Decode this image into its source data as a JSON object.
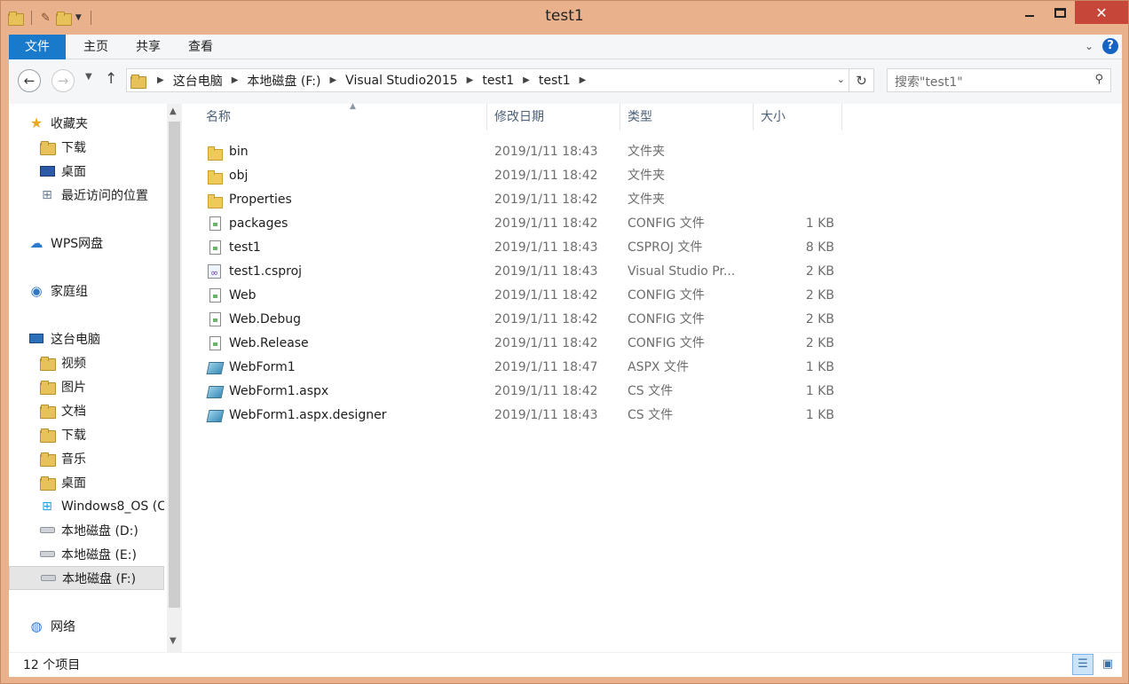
{
  "window": {
    "title": "test1"
  },
  "ribbon": {
    "tabs": [
      "文件",
      "主页",
      "共享",
      "查看"
    ]
  },
  "address": {
    "crumbs": [
      "这台电脑",
      "本地磁盘 (F:)",
      "Visual Studio2015",
      "test1",
      "test1"
    ]
  },
  "search": {
    "placeholder": "搜索\"test1\""
  },
  "nav": {
    "items": [
      {
        "label": "收藏夹",
        "icon": "star-icon",
        "level": 0
      },
      {
        "label": "下载",
        "icon": "downloads-folder-icon",
        "level": 1
      },
      {
        "label": "桌面",
        "icon": "desktop-icon",
        "level": 1
      },
      {
        "label": "最近访问的位置",
        "icon": "recent-places-icon",
        "level": 1
      },
      {
        "label": "WPS网盘",
        "icon": "cloud-icon",
        "level": 0
      },
      {
        "label": "家庭组",
        "icon": "homegroup-icon",
        "level": 0
      },
      {
        "label": "这台电脑",
        "icon": "computer-icon",
        "level": 0
      },
      {
        "label": "视频",
        "icon": "videos-folder-icon",
        "level": 1
      },
      {
        "label": "图片",
        "icon": "pictures-folder-icon",
        "level": 1
      },
      {
        "label": "文档",
        "icon": "documents-folder-icon",
        "level": 1
      },
      {
        "label": "下载",
        "icon": "downloads-folder-icon",
        "level": 1
      },
      {
        "label": "音乐",
        "icon": "music-folder-icon",
        "level": 1
      },
      {
        "label": "桌面",
        "icon": "desktop-folder-icon",
        "level": 1
      },
      {
        "label": "Windows8_OS (C",
        "icon": "windows-drive-icon",
        "level": 1
      },
      {
        "label": "本地磁盘 (D:)",
        "icon": "drive-icon",
        "level": 1
      },
      {
        "label": "本地磁盘 (E:)",
        "icon": "drive-icon",
        "level": 1
      },
      {
        "label": "本地磁盘 (F:)",
        "icon": "drive-icon",
        "level": 1,
        "selected": true
      },
      {
        "label": "网络",
        "icon": "network-icon",
        "level": 0
      }
    ]
  },
  "columns": {
    "name": "名称",
    "date": "修改日期",
    "type": "类型",
    "size": "大小"
  },
  "files": [
    {
      "name": "bin",
      "date": "2019/1/11 18:43",
      "type": "文件夹",
      "size": "",
      "icon": "folder"
    },
    {
      "name": "obj",
      "date": "2019/1/11 18:42",
      "type": "文件夹",
      "size": "",
      "icon": "folder"
    },
    {
      "name": "Properties",
      "date": "2019/1/11 18:42",
      "type": "文件夹",
      "size": "",
      "icon": "folder"
    },
    {
      "name": "packages",
      "date": "2019/1/11 18:42",
      "type": "CONFIG 文件",
      "size": "1 KB",
      "icon": "doc"
    },
    {
      "name": "test1",
      "date": "2019/1/11 18:43",
      "type": "CSPROJ 文件",
      "size": "8 KB",
      "icon": "doc"
    },
    {
      "name": "test1.csproj",
      "date": "2019/1/11 18:43",
      "type": "Visual Studio Pr...",
      "size": "2 KB",
      "icon": "proj"
    },
    {
      "name": "Web",
      "date": "2019/1/11 18:42",
      "type": "CONFIG 文件",
      "size": "2 KB",
      "icon": "doc"
    },
    {
      "name": "Web.Debug",
      "date": "2019/1/11 18:42",
      "type": "CONFIG 文件",
      "size": "2 KB",
      "icon": "doc"
    },
    {
      "name": "Web.Release",
      "date": "2019/1/11 18:42",
      "type": "CONFIG 文件",
      "size": "2 KB",
      "icon": "doc"
    },
    {
      "name": "WebForm1",
      "date": "2019/1/11 18:47",
      "type": "ASPX 文件",
      "size": "1 KB",
      "icon": "cs"
    },
    {
      "name": "WebForm1.aspx",
      "date": "2019/1/11 18:42",
      "type": "CS 文件",
      "size": "1 KB",
      "icon": "cs"
    },
    {
      "name": "WebForm1.aspx.designer",
      "date": "2019/1/11 18:43",
      "type": "CS 文件",
      "size": "1 KB",
      "icon": "cs"
    }
  ],
  "status": {
    "count": "12 个项目"
  },
  "colors": {
    "titlebar": "#e9b28c",
    "file_tab": "#1979ca",
    "close": "#c7463a"
  }
}
